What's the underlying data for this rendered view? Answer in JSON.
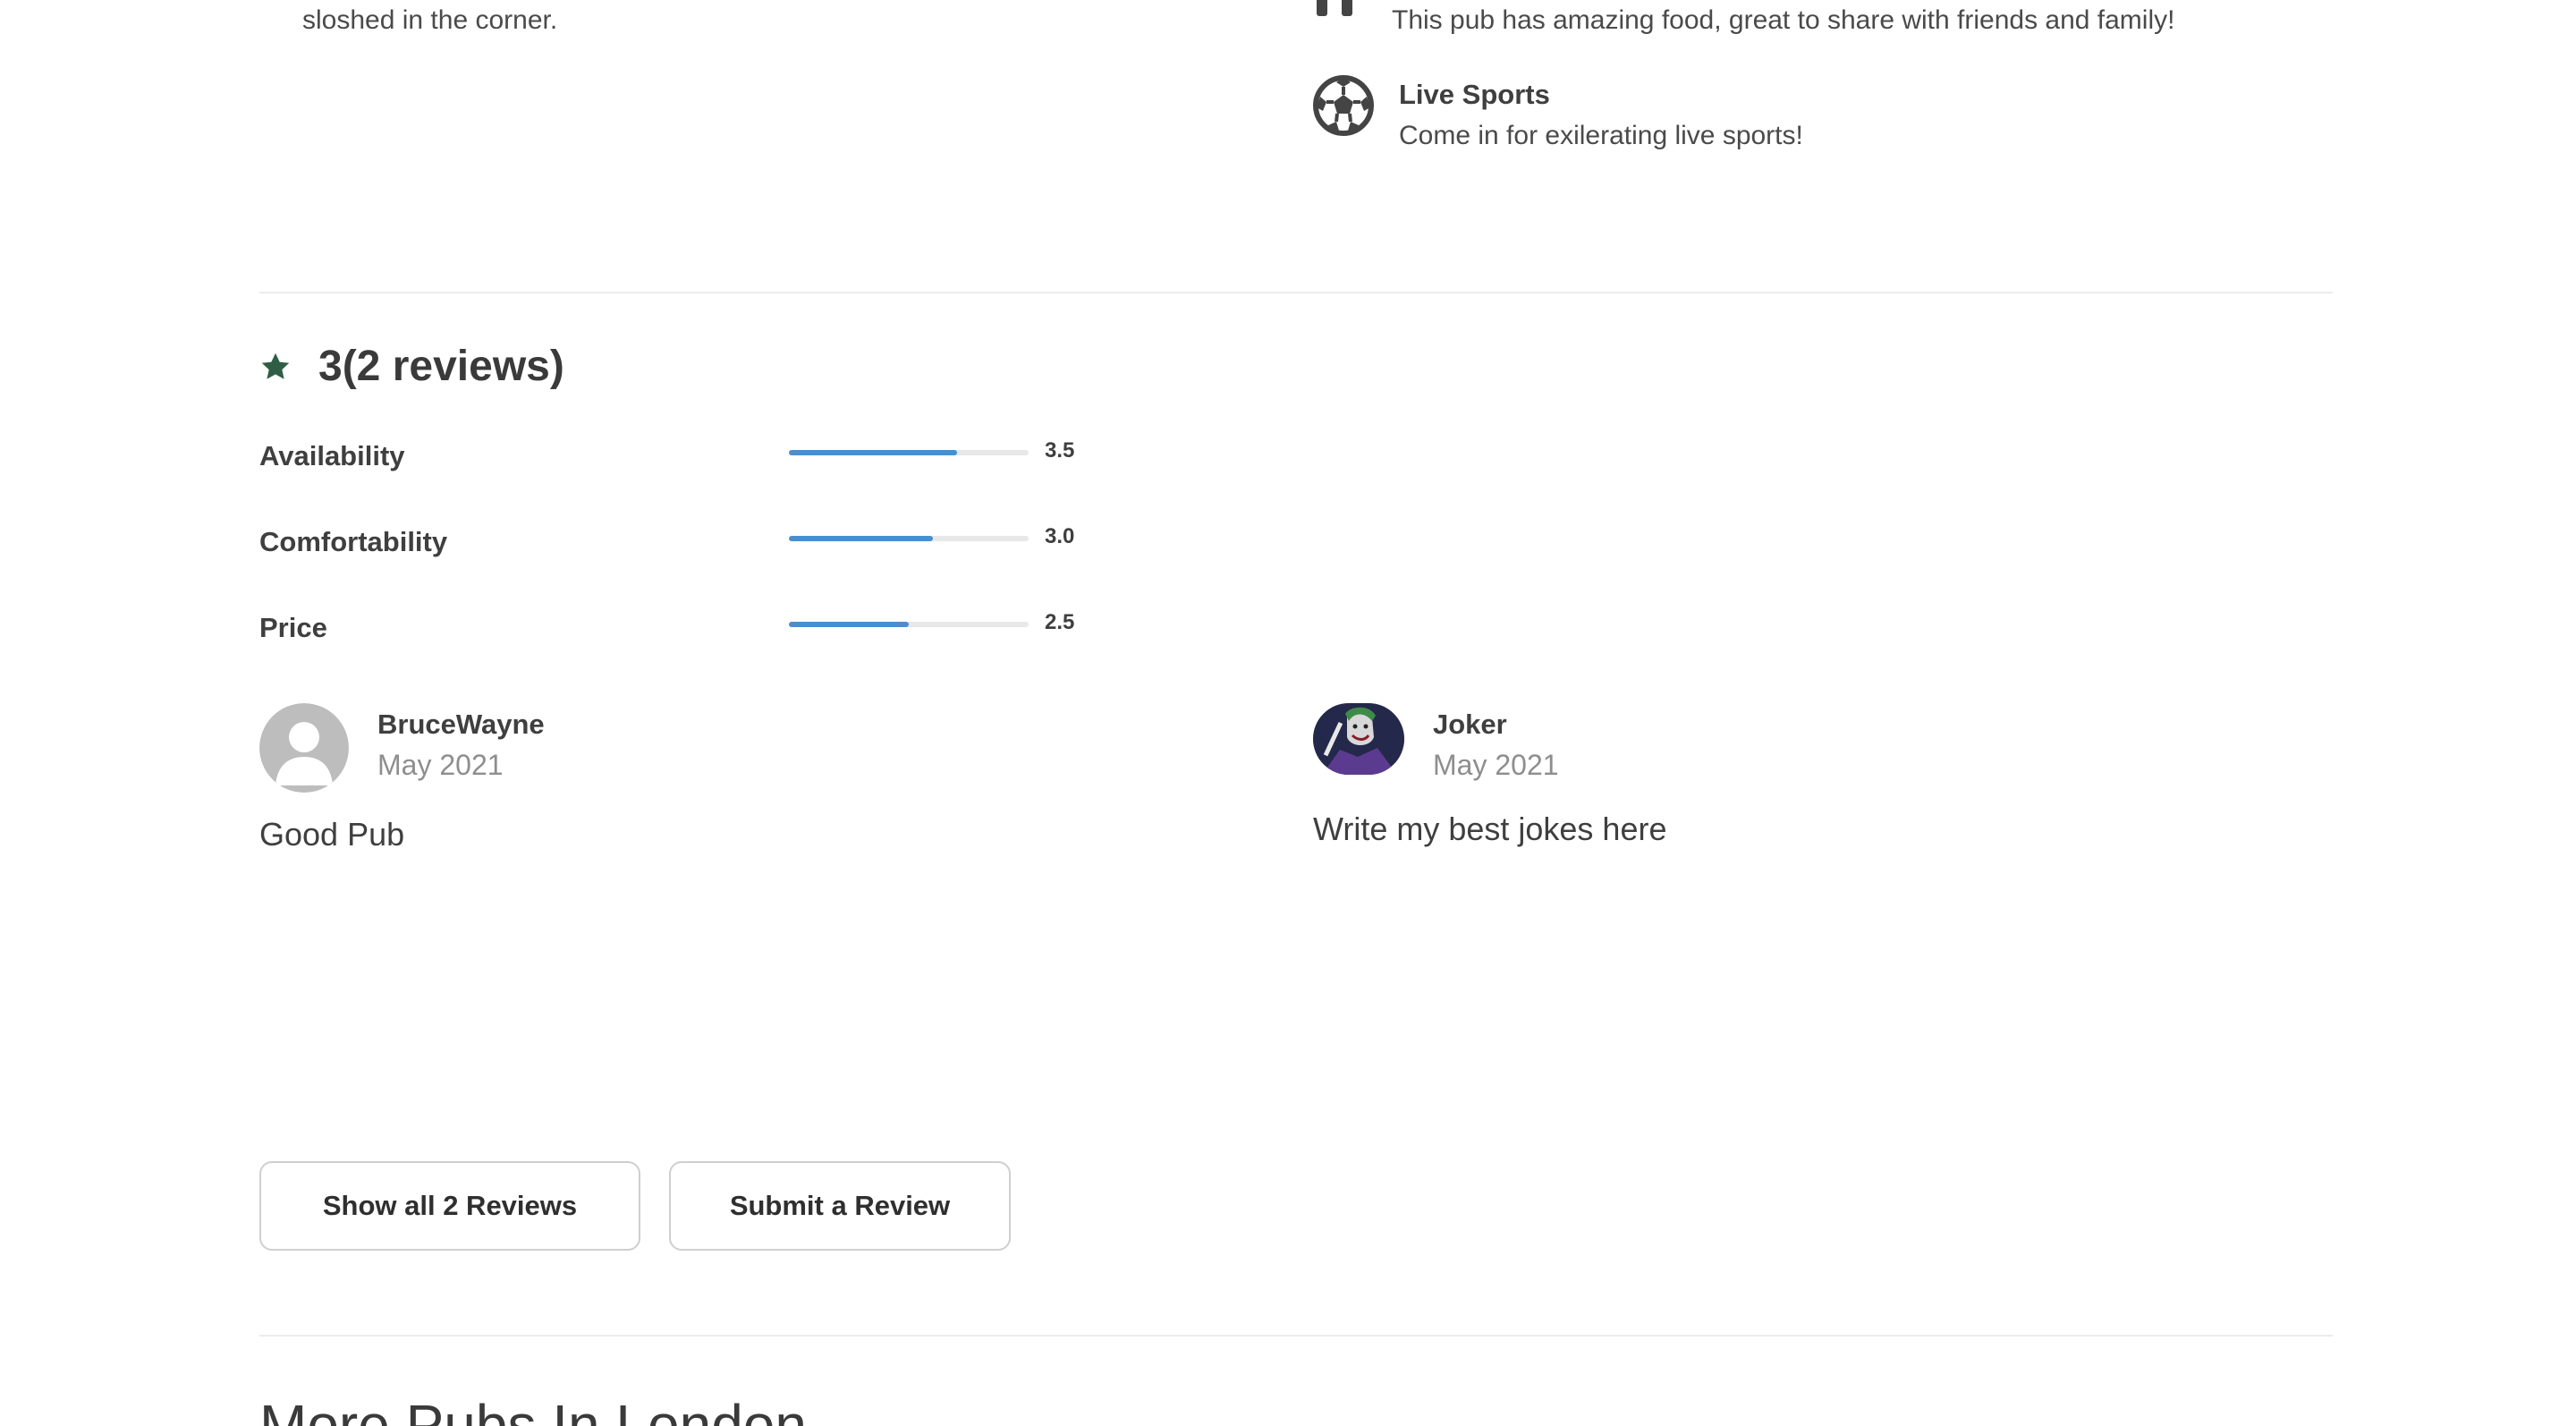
{
  "top": {
    "left_text": "sloshed in the corner.",
    "food_description": "This pub has amazing food, great to share with friends and family!",
    "amenity": {
      "title": "Live Sports",
      "description": "Come in for exilerating live sports!",
      "icon": "soccer-ball-icon"
    }
  },
  "rating": {
    "score_text": "3(2 reviews)",
    "star_icon": "star-icon",
    "accent_color": "#2f5e45",
    "bar_color": "#4a8ed0",
    "criteria": [
      {
        "label": "Availability",
        "value": "3.5",
        "fraction": 0.7
      },
      {
        "label": "Comfortability",
        "value": "3.0",
        "fraction": 0.6
      },
      {
        "label": "Price",
        "value": "2.5",
        "fraction": 0.5
      }
    ]
  },
  "reviews": [
    {
      "name": "BruceWayne",
      "date": "May 2021",
      "text": "Good Pub",
      "avatar": "default-avatar"
    },
    {
      "name": "Joker",
      "date": "May 2021",
      "text": "Write my best jokes here",
      "avatar": "joker-avatar"
    }
  ],
  "buttons": {
    "show_all": "Show all 2 Reviews",
    "submit": "Submit a Review"
  },
  "more_heading": "More Pubs In London"
}
